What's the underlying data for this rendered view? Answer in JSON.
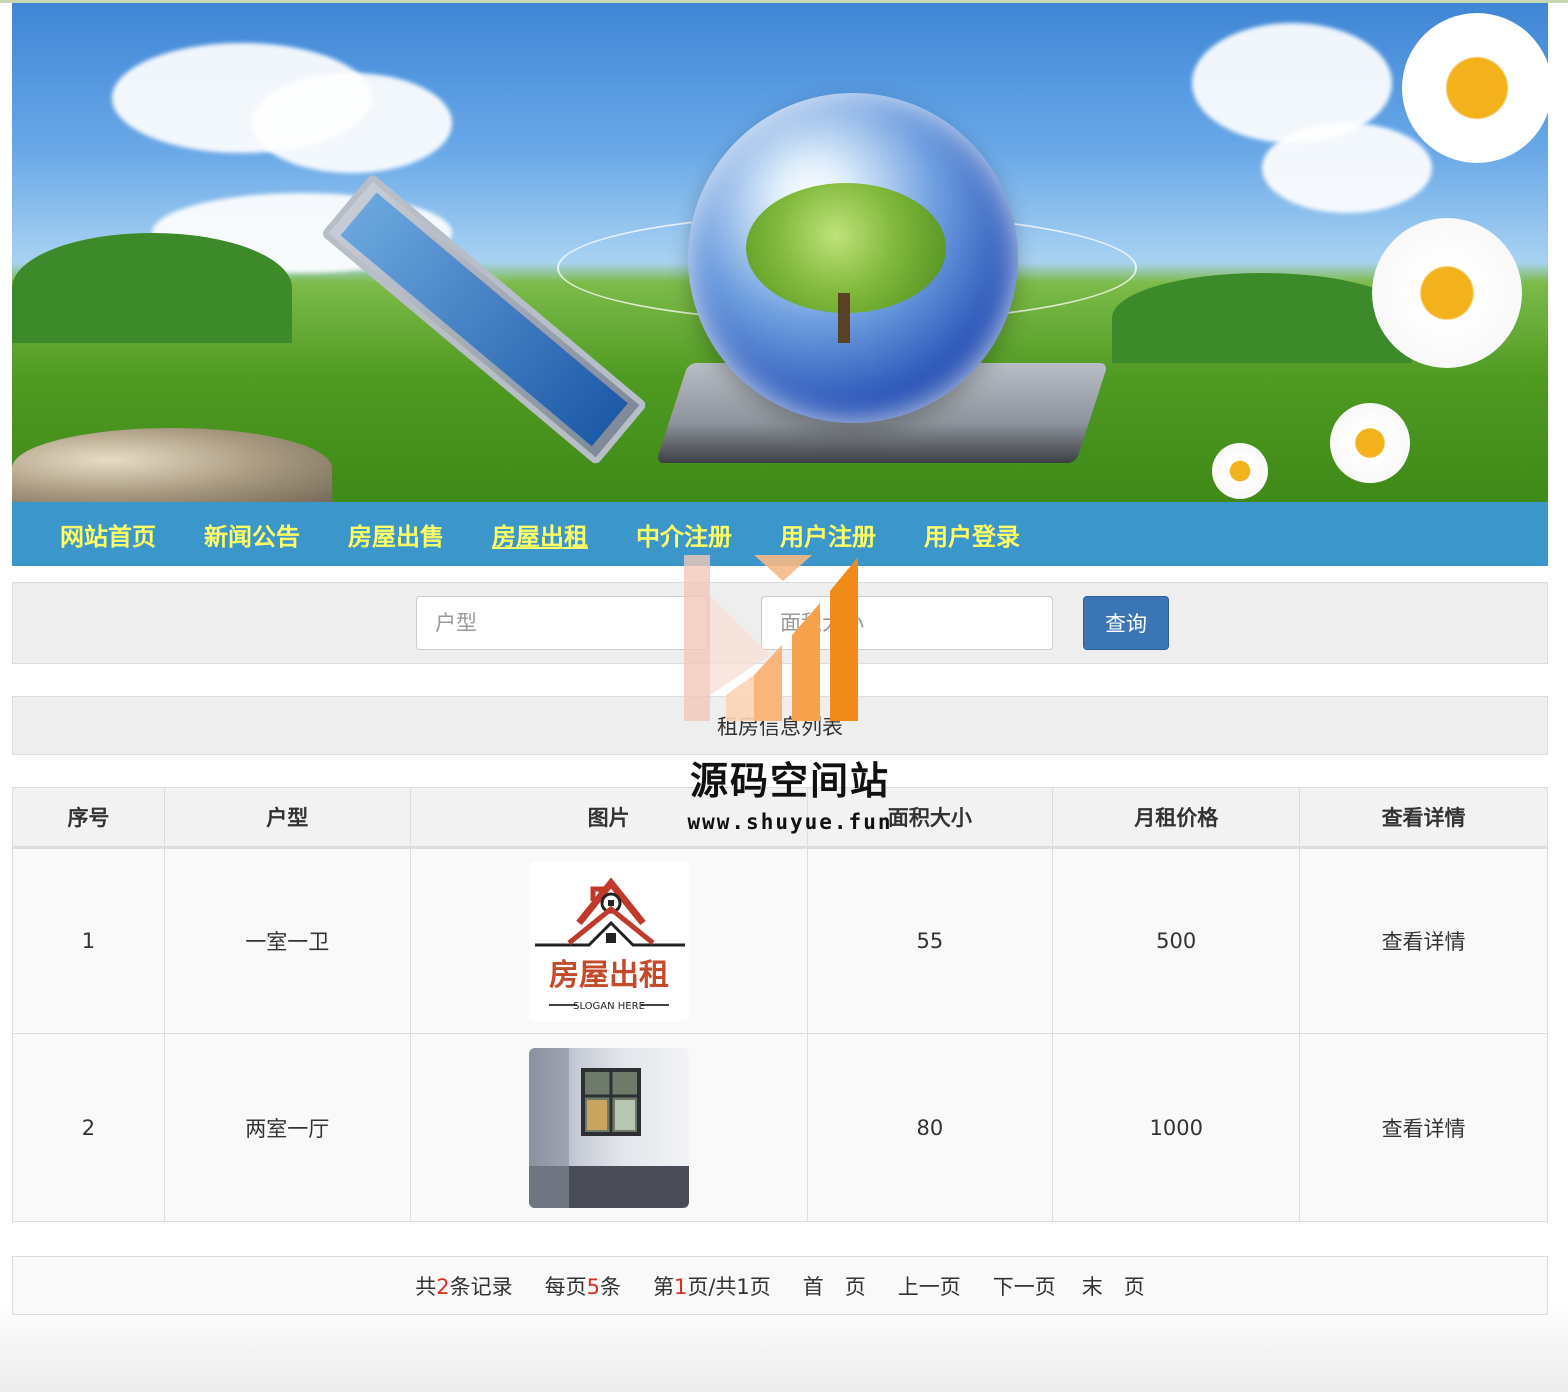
{
  "nav": {
    "items": [
      {
        "label": "网站首页",
        "name": "nav-home"
      },
      {
        "label": "新闻公告",
        "name": "nav-news"
      },
      {
        "label": "房屋出售",
        "name": "nav-house-sale"
      },
      {
        "label": "房屋出租",
        "name": "nav-house-rent",
        "active": true
      },
      {
        "label": "中介注册",
        "name": "nav-agent-register"
      },
      {
        "label": "用户注册",
        "name": "nav-user-register"
      },
      {
        "label": "用户登录",
        "name": "nav-user-login"
      }
    ]
  },
  "search": {
    "type_placeholder": "户型",
    "area_placeholder": "面积大小",
    "button_label": "查询"
  },
  "list": {
    "title": "租房信息列表",
    "columns": [
      "序号",
      "户型",
      "图片",
      "面积大小",
      "月租价格",
      "查看详情"
    ],
    "rows": [
      {
        "index": "1",
        "type": "一室一卫",
        "image": "house-rent-logo",
        "area": "55",
        "price": "500",
        "detail": "查看详情"
      },
      {
        "index": "2",
        "type": "两室一厅",
        "image": "empty-room-photo",
        "area": "80",
        "price": "1000",
        "detail": "查看详情"
      }
    ]
  },
  "pager": {
    "total_prefix": "共",
    "total": "2",
    "total_suffix": "条记录",
    "per_prefix": "每页",
    "per": "5",
    "per_suffix": "条",
    "page_prefix": "第",
    "page": "1",
    "page_suffix": "页/共1页",
    "first": "首　页",
    "prev": "上一页",
    "next": "下一页",
    "last": "末　页"
  },
  "logo_card": {
    "text": "房屋出租",
    "slogan": "SLOGAN HERE"
  },
  "watermark": {
    "title": "源码空间站",
    "url": "www.shuyue.fun"
  },
  "colors": {
    "nav_bg": "#3b97c9",
    "nav_text": "#ffff66",
    "button_bg": "#3a75b6",
    "pager_number": "#d9301f"
  }
}
